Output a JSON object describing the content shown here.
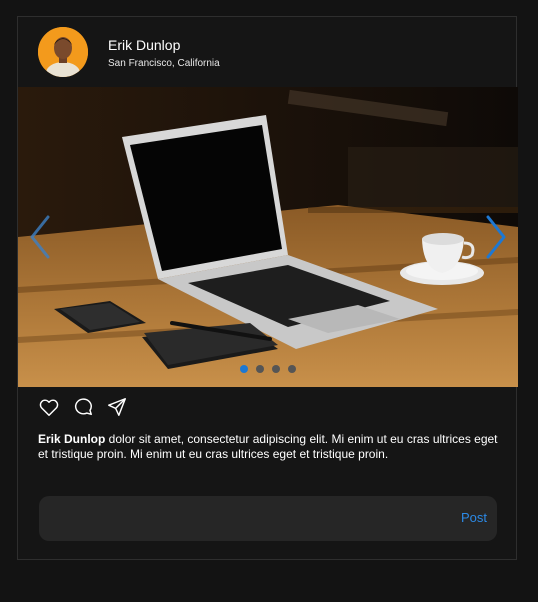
{
  "post": {
    "author": {
      "name": "Erik Dunlop",
      "location": "San Francisco, California",
      "avatar_icon": "avatar-portrait"
    },
    "carousel": {
      "image_icon": "laptop-on-wooden-table-photo",
      "slide_count": 4,
      "active_slide": 1,
      "prev_icon": "chevron-left-icon",
      "next_icon": "chevron-right-icon"
    },
    "actions": [
      "heart-icon",
      "comment-icon",
      "share-icon"
    ],
    "caption": {
      "author": "Erik Dunlop",
      "text": " dolor sit amet, consectetur adipiscing elit. Mi enim ut eu cras ultrices eget et tristique proin. Mi enim ut eu cras ultrices eget et tristique proin."
    },
    "comment": {
      "value": "",
      "post_label": "Post"
    }
  },
  "colors": {
    "accent": "#1d78d3",
    "post_button": "#2c8ae6",
    "avatar_bg": "#f39a1c",
    "card_bg": "#151515",
    "input_bg": "#262626"
  }
}
